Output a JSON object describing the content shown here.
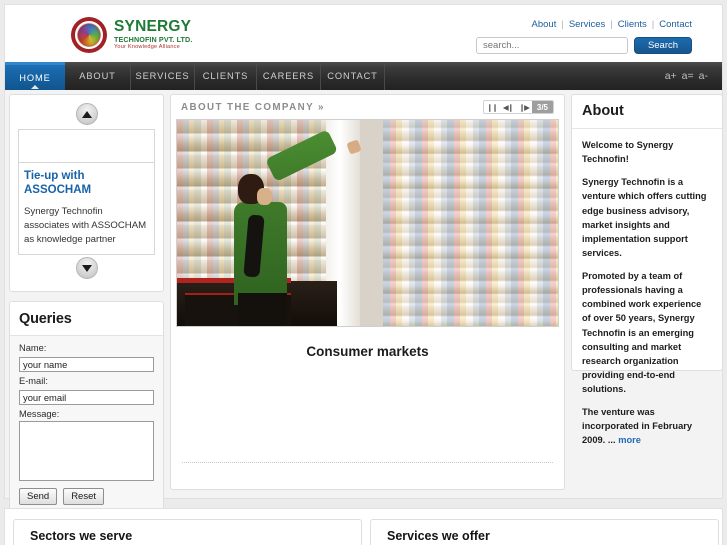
{
  "brand": {
    "name": "SYNERGY",
    "subtitle": "TECHNOFIN PVT. LTD.",
    "tagline": "Your Knowledge Alliance"
  },
  "toplinks": [
    {
      "label": "About"
    },
    {
      "label": "Services"
    },
    {
      "label": "Clients"
    },
    {
      "label": "Contact"
    }
  ],
  "separator": "|",
  "search": {
    "placeholder": "search...",
    "value": "",
    "button_label": "Search"
  },
  "nav": {
    "items": [
      {
        "label": "HOME",
        "active": true
      },
      {
        "label": "ABOUT",
        "active": false
      },
      {
        "label": "SERVICES",
        "active": false
      },
      {
        "label": "CLIENTS",
        "active": false
      },
      {
        "label": "CAREERS",
        "active": false
      },
      {
        "label": "CONTACT",
        "active": false
      }
    ],
    "font_sizers": [
      "a+",
      "a=",
      "a-"
    ]
  },
  "news": {
    "up_icon": "triangle-up-icon",
    "down_icon": "triangle-down-icon",
    "title": "Tie-up with ASSOCHAM",
    "text": "Synergy Technofin associates with ASSOCHAM as knowledge partner"
  },
  "queries": {
    "heading": "Queries",
    "name_label": "Name:",
    "name_value": "your name",
    "email_label": "E-mail:",
    "email_value": "your email",
    "message_label": "Message:",
    "message_value": "",
    "send_label": "Send",
    "reset_label": "Reset"
  },
  "slider": {
    "title": "ABOUT THE COMPANY »",
    "pause_icon": "pause-icon",
    "prev_icon": "previous-icon",
    "next_icon": "next-icon",
    "pause_glyph": "❙❙",
    "prev_glyph": "◀❙",
    "next_glyph": "❙▶",
    "counter": "3/5",
    "caption": "Consumer markets",
    "image_alt": "supermarket-aisle-photo"
  },
  "about": {
    "heading": "About",
    "paragraphs": [
      "Welcome to Synergy Technofin!",
      "Synergy Technofin is a venture which offers cutting edge business advisory, market insights and implementation support services.",
      "Promoted by a team of professionals having a combined work experience of over 50 years, Synergy Technofin is an emerging consulting and market research organization providing end-to-end solutions."
    ],
    "last_paragraph": "The venture was incorporated in February 2009. ...",
    "more_label": "more"
  },
  "bottom": {
    "sectors_heading": "Sectors we serve",
    "services_heading": "Services we offer"
  },
  "colors": {
    "brand_green": "#1e7a34",
    "brand_red": "#a02226",
    "link_blue": "#1f5fa0",
    "nav_active": "#1766a8",
    "nav_bg": "#2c2c2c"
  }
}
